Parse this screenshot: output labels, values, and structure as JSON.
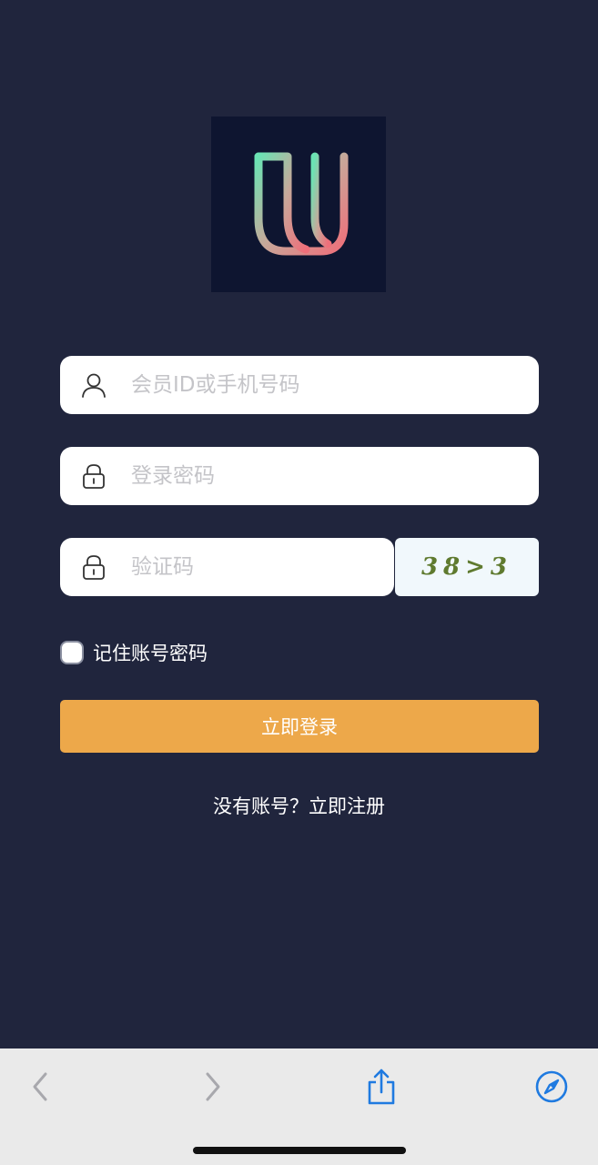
{
  "login_form": {
    "member_id": {
      "placeholder": "会员ID或手机号码",
      "value": "",
      "icon": "user-icon"
    },
    "password": {
      "placeholder": "登录密码",
      "value": "",
      "icon": "lock-icon"
    },
    "captcha": {
      "placeholder": "验证码",
      "value": "",
      "icon": "lock-icon",
      "image_text": "38>3"
    },
    "remember": {
      "label": "记住账号密码",
      "checked": false
    },
    "submit_label": "立即登录",
    "register_prompt": "没有账号？",
    "register_link": "立即注册"
  },
  "browser_toolbar": {
    "icons": [
      "back-icon",
      "forward-icon",
      "share-icon",
      "compass-icon"
    ],
    "accent": "#1f7ae0"
  },
  "colors": {
    "background": "#20253d",
    "logo_background": "#0e1530",
    "button": "#eda84a",
    "captcha_text": "#5f7a2f"
  }
}
